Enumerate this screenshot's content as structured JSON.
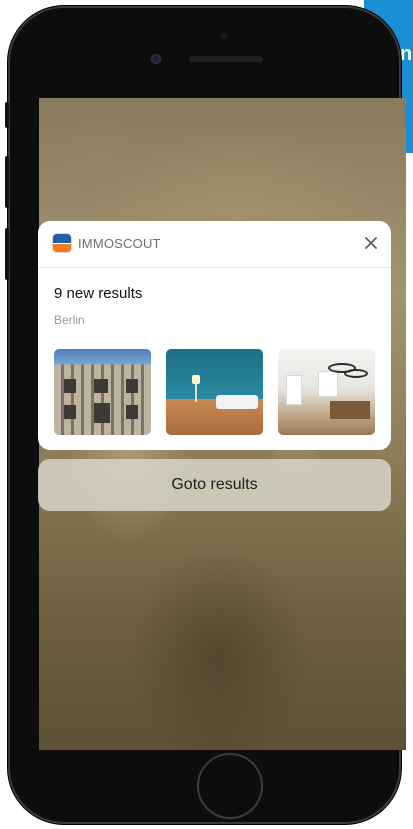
{
  "banner": {
    "text": "n",
    "color": "#1a8fd6"
  },
  "notification": {
    "app_name": "IMMOSCOUT",
    "app_icon": "immoscout-app-icon",
    "close_icon": "close-icon",
    "title": "9 new results",
    "subtitle": "Berlin",
    "thumbnails": [
      {
        "name": "building-facade-thumbnail"
      },
      {
        "name": "living-room-thumbnail"
      },
      {
        "name": "kitchen-interior-thumbnail"
      }
    ]
  },
  "action": {
    "label": "Goto results"
  }
}
